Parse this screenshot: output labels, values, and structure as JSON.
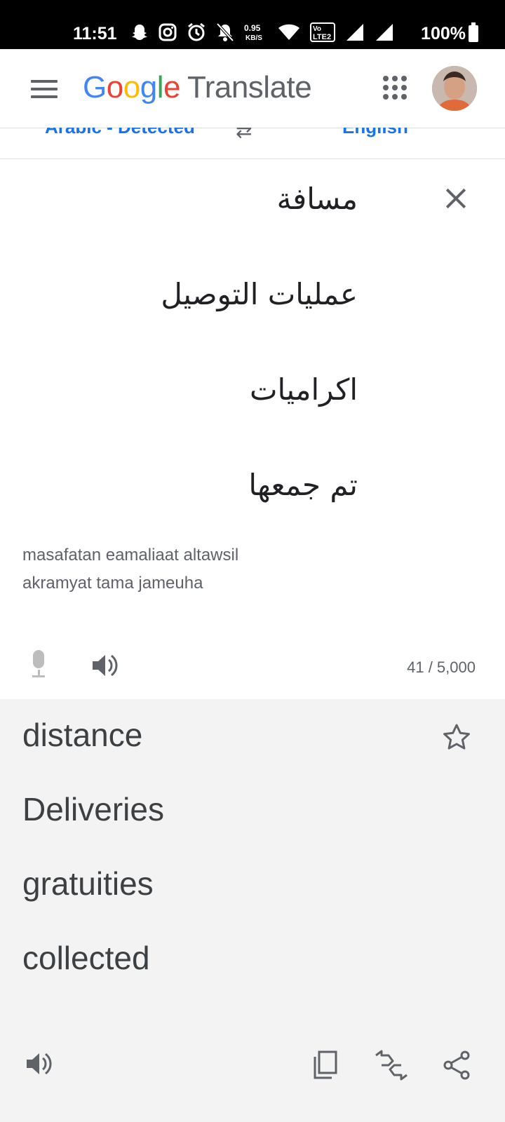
{
  "status_bar": {
    "time": "11:51",
    "data_rate": "0.95 KB/S",
    "network": "Vo LTE 2",
    "battery": "100%",
    "icons": [
      "snapchat-icon",
      "instagram-icon",
      "alarm-icon",
      "bell-off-icon",
      "data-speed-icon",
      "wifi-icon",
      "volte-icon",
      "signal-icon",
      "signal-icon",
      "battery-icon"
    ]
  },
  "app_bar": {
    "brand_google": "Google",
    "brand_product": "Translate"
  },
  "language_bar": {
    "source_language": "Arabic - Detected",
    "target_language": "English"
  },
  "source": {
    "lines": [
      "مسافة",
      "عمليات التوصيل",
      "اكراميات",
      "تم جمعها"
    ],
    "transliteration_line1": "masafatan eamaliaat altawsil",
    "transliteration_line2": "akramyat tama jameuha",
    "char_count": "41 / 5,000"
  },
  "translation": {
    "lines": [
      "distance",
      "Deliveries",
      "gratuities",
      "collected"
    ]
  },
  "colors": {
    "accent": "#1a73e8",
    "translation_bg": "#f3f3f3",
    "status_bar_bg": "#000000"
  }
}
